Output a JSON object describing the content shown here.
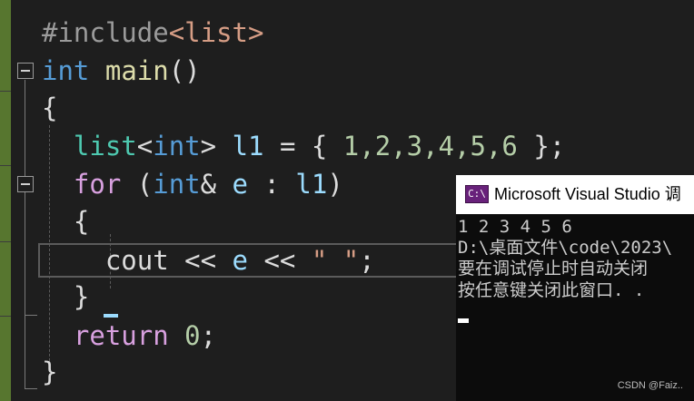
{
  "editor": {
    "lines": [
      {
        "include": "#include",
        "header": "<list>"
      },
      {
        "type": "int",
        "name": "main",
        "parens": "()"
      },
      {
        "brace": "{"
      },
      {
        "type": "list",
        "open": "<",
        "tparam": "int",
        "close": ">",
        "var": "l1",
        "rest_eq": " = { ",
        "values": "1,2,3,4,5,6",
        "end": " };"
      },
      {
        "kw": "for",
        "open": " (",
        "type": "int",
        "amp": "& ",
        "var": "e",
        "colon": " : ",
        "range": "l1",
        "close": ")"
      },
      {
        "brace": "{"
      },
      {
        "stream": "cout",
        "op1": " << ",
        "var": "e",
        "op2": " << ",
        "str": "\" \"",
        "end": ";"
      },
      {
        "brace": "}"
      },
      {
        "kw": "return",
        "sp": " ",
        "num": "0",
        "end": ";"
      },
      {
        "brace": "}"
      }
    ]
  },
  "console": {
    "title": "Microsoft Visual Studio 调",
    "icon_text": "C:\\",
    "output": [
      "1 2 3 4 5 6",
      "D:\\桌面文件\\code\\2023\\",
      "要在调试停止时自动关闭",
      "按任意键关闭此窗口. ."
    ]
  },
  "watermark": "CSDN @Faiz.."
}
